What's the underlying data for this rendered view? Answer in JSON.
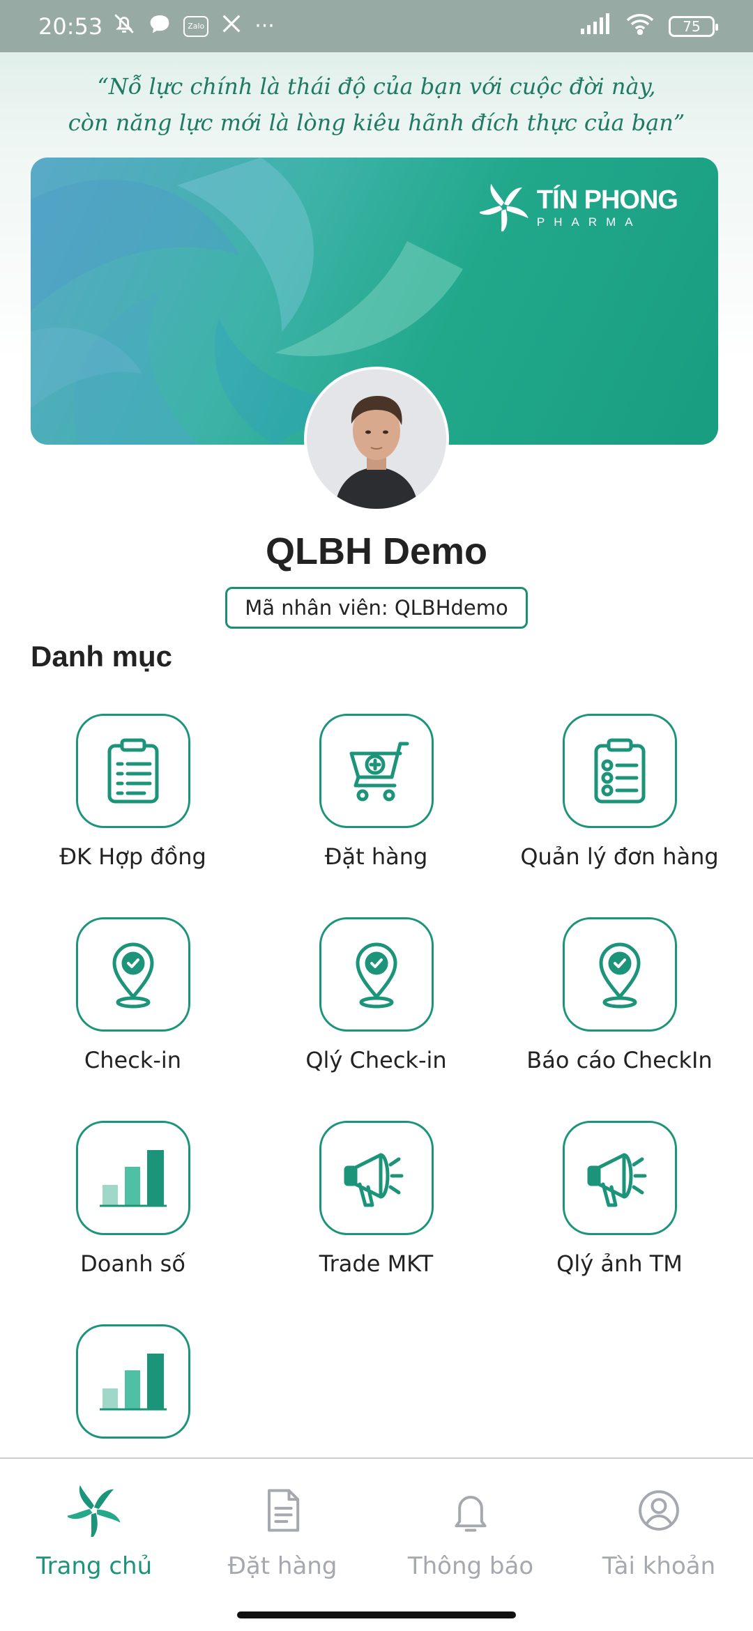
{
  "status_bar": {
    "time": "20:53",
    "zalo_label": "Zalo",
    "more": "···",
    "battery": "75"
  },
  "quote": {
    "line1": "“Nỗ lực chính là thái độ của bạn với cuộc đời này,",
    "line2": "còn năng lực mới là lòng kiêu hãnh đích thực của bạn”"
  },
  "brand": {
    "name": "TÍN PHONG",
    "sub": "PHARMA"
  },
  "profile": {
    "name": "QLBH Demo",
    "employee_code": "Mã nhân viên: QLBHdemo"
  },
  "section_title": "Danh mục",
  "menu": [
    {
      "label": "ĐK Hợp đồng",
      "icon": "clipboard-list-icon"
    },
    {
      "label": "Đặt hàng",
      "icon": "cart-plus-icon"
    },
    {
      "label": "Quản lý đơn hàng",
      "icon": "clipboard-check-icon"
    },
    {
      "label": "Check-in",
      "icon": "location-check-icon"
    },
    {
      "label": "Qlý Check-in",
      "icon": "location-check-icon"
    },
    {
      "label": "Báo cáo CheckIn",
      "icon": "location-check-icon"
    },
    {
      "label": "Doanh số",
      "icon": "bar-chart-icon"
    },
    {
      "label": "Trade MKT",
      "icon": "megaphone-icon"
    },
    {
      "label": "Qlý ảnh TM",
      "icon": "megaphone-icon"
    },
    {
      "label": "",
      "icon": "bar-chart-icon"
    }
  ],
  "bottom_nav": [
    {
      "label": "Trang chủ",
      "icon": "pinwheel-icon",
      "active": true
    },
    {
      "label": "Đặt hàng",
      "icon": "document-icon",
      "active": false
    },
    {
      "label": "Thông báo",
      "icon": "bell-icon",
      "active": false
    },
    {
      "label": "Tài khoản",
      "icon": "user-circle-icon",
      "active": false
    }
  ],
  "colors": {
    "accent": "#1b9479",
    "quote": "#1e7a63",
    "inactive": "#a5a8ae"
  }
}
